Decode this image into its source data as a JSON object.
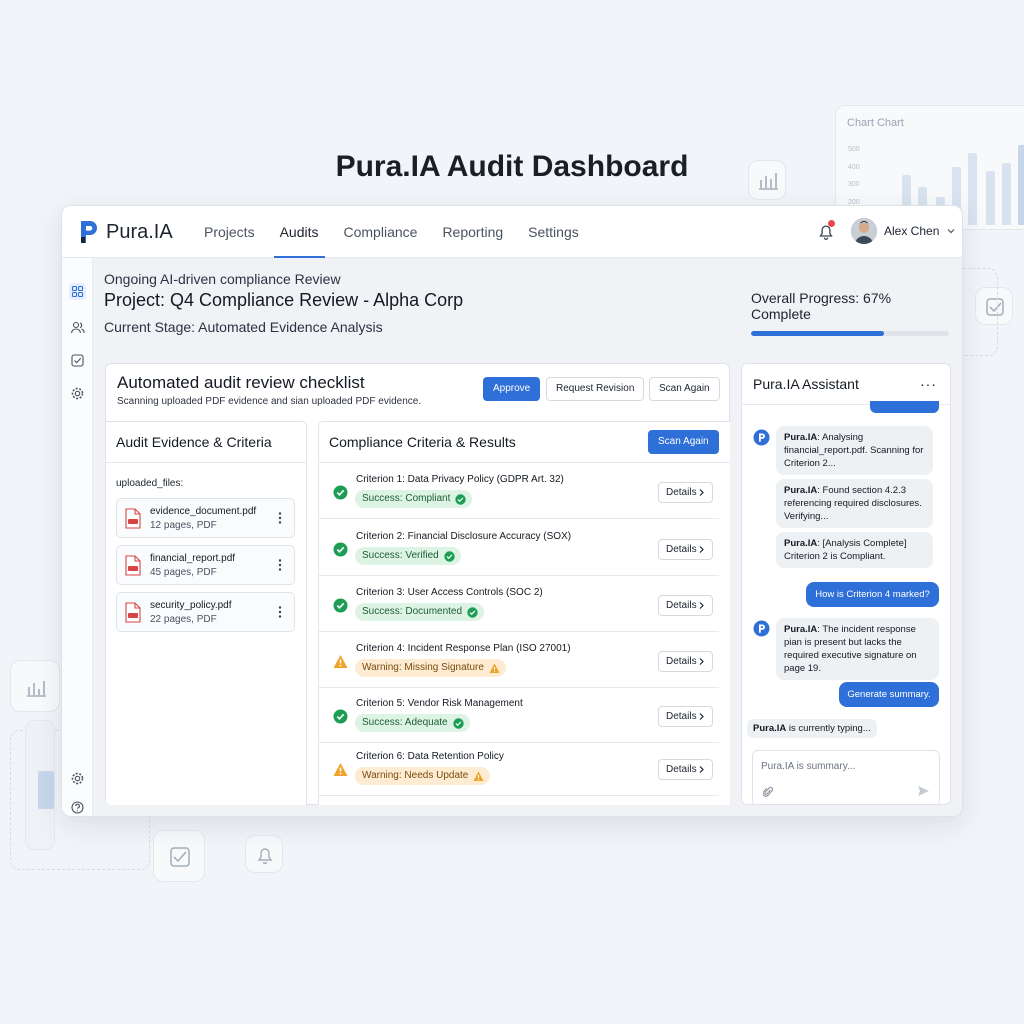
{
  "page": {
    "hero_title": "Pura.IA Audit Dashboard"
  },
  "background_chart": {
    "title": "Chart Chart",
    "ticks": [
      "500",
      "400",
      "300",
      "200"
    ]
  },
  "app": {
    "logo_text": "Pura.IA",
    "nav": [
      {
        "label": "Projects",
        "active": false
      },
      {
        "label": "Audits",
        "active": true
      },
      {
        "label": "Compliance",
        "active": false
      },
      {
        "label": "Reporting",
        "active": false
      },
      {
        "label": "Settings",
        "active": false
      }
    ],
    "user_name": "Alex Chen",
    "accent_color": "#2f6fd8"
  },
  "project": {
    "subtitle": "Ongoing AI-driven compliance Review",
    "title": "Project: Q4 Compliance Review - Alpha Corp",
    "stage": "Current Stage: Automated Evidence Analysis",
    "progress_label": "Overall Progress: 67% Complete",
    "progress_percent": 67
  },
  "checklist": {
    "title": "Automated audit review checklist",
    "subtitle": "Scanning uploaded PDF evidence and sian uploaded PDF evidence.",
    "approve_label": "Approve",
    "request_revision_label": "Request Revision",
    "scan_again_label": "Scan Again"
  },
  "evidence": {
    "heading": "Audit Evidence & Criteria",
    "files_label": "uploaded_files:",
    "files": [
      {
        "name": "evidence_document.pdf",
        "meta": "12 pages, PDF"
      },
      {
        "name": "financial_report.pdf",
        "meta": "45 pages, PDF"
      },
      {
        "name": "security_policy.pdf",
        "meta": "22 pages, PDF"
      }
    ]
  },
  "criteria": {
    "heading": "Compliance Criteria & Results",
    "scan_again_label": "Scan Again",
    "details_label": "Details",
    "items": [
      {
        "name": "Criterion 1: Data Privacy Policy (GDPR Art. 32)",
        "status": "success",
        "badge": "Success: Compliant"
      },
      {
        "name": "Criterion 2: Financial Disclosure Accuracy (SOX)",
        "status": "success",
        "badge": "Success: Verified"
      },
      {
        "name": "Criterion 3: User Access Controls (SOC 2)",
        "status": "success",
        "badge": "Success: Documented"
      },
      {
        "name": "Criterion 4: Incident Response Plan (ISO 27001)",
        "status": "warning",
        "badge": "Warning: Missing Signature"
      },
      {
        "name": "Criterion 5: Vendor Risk Management",
        "status": "success",
        "badge": "Success: Adequate"
      },
      {
        "name": "Criterion 6: Data Retention Policy",
        "status": "warning",
        "badge": "Warning: Needs Update"
      }
    ]
  },
  "assistant": {
    "heading": "Pura.IA Assistant",
    "more_label": "···",
    "sender": "Pura.IA",
    "messages": [
      {
        "text": ": Analysing financial_report.pdf. Scanning for Criterion 2..."
      },
      {
        "text": ": Found section 4.2.3 referencing required disclosures. Verifying..."
      },
      {
        "text": ": [Analysis Complete] Criterion 2 is Compliant."
      },
      {
        "text": "How is Criterion 4 marked?"
      },
      {
        "text": ": The incident response pian is present but lacks the required executive signature on page 19."
      },
      {
        "text": "Generate summary."
      }
    ],
    "typing_text": " is currently typing...",
    "input_placeholder": "Pura.IA is summary..."
  }
}
